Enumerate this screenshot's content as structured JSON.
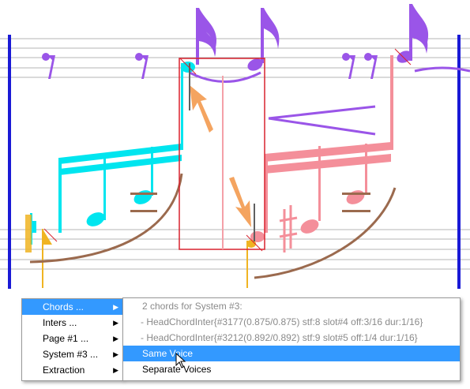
{
  "colors": {
    "staff_line": "#b4b4b4",
    "barline": "#1a1ad6",
    "voice_purple": "#9a55e8",
    "voice_cyan": "#00e5ef",
    "voice_pink": "#f48f9a",
    "voice_yellow": "#f0b422",
    "slur_brown": "#9b6a4e",
    "selection_box": "#d8222e",
    "arrow_orange": "#f4a460",
    "menu_highlight": "#3399ff"
  },
  "context_menu": {
    "items": [
      {
        "label": "Chords ...",
        "has_submenu": true,
        "selected": true
      },
      {
        "label": "Inters ...",
        "has_submenu": true,
        "selected": false
      },
      {
        "label": "Page #1 ...",
        "has_submenu": true,
        "selected": false
      },
      {
        "label": "System #3 ...",
        "has_submenu": true,
        "selected": false
      },
      {
        "label": "Extraction",
        "has_submenu": true,
        "selected": false
      }
    ]
  },
  "chords_submenu": {
    "header": "2 chords for System #3:",
    "chords": [
      "- HeadChordInter{#3177(0.875/0.875) stf:8 slot#4 off:3/16 dur:1/16}",
      "- HeadChordInter{#3212(0.892/0.892) stf:9 slot#5 off:1/4 dur:1/16}"
    ],
    "actions": [
      {
        "label": "Same Voice",
        "selected": true
      },
      {
        "label": "Separate Voices",
        "selected": false
      }
    ]
  }
}
